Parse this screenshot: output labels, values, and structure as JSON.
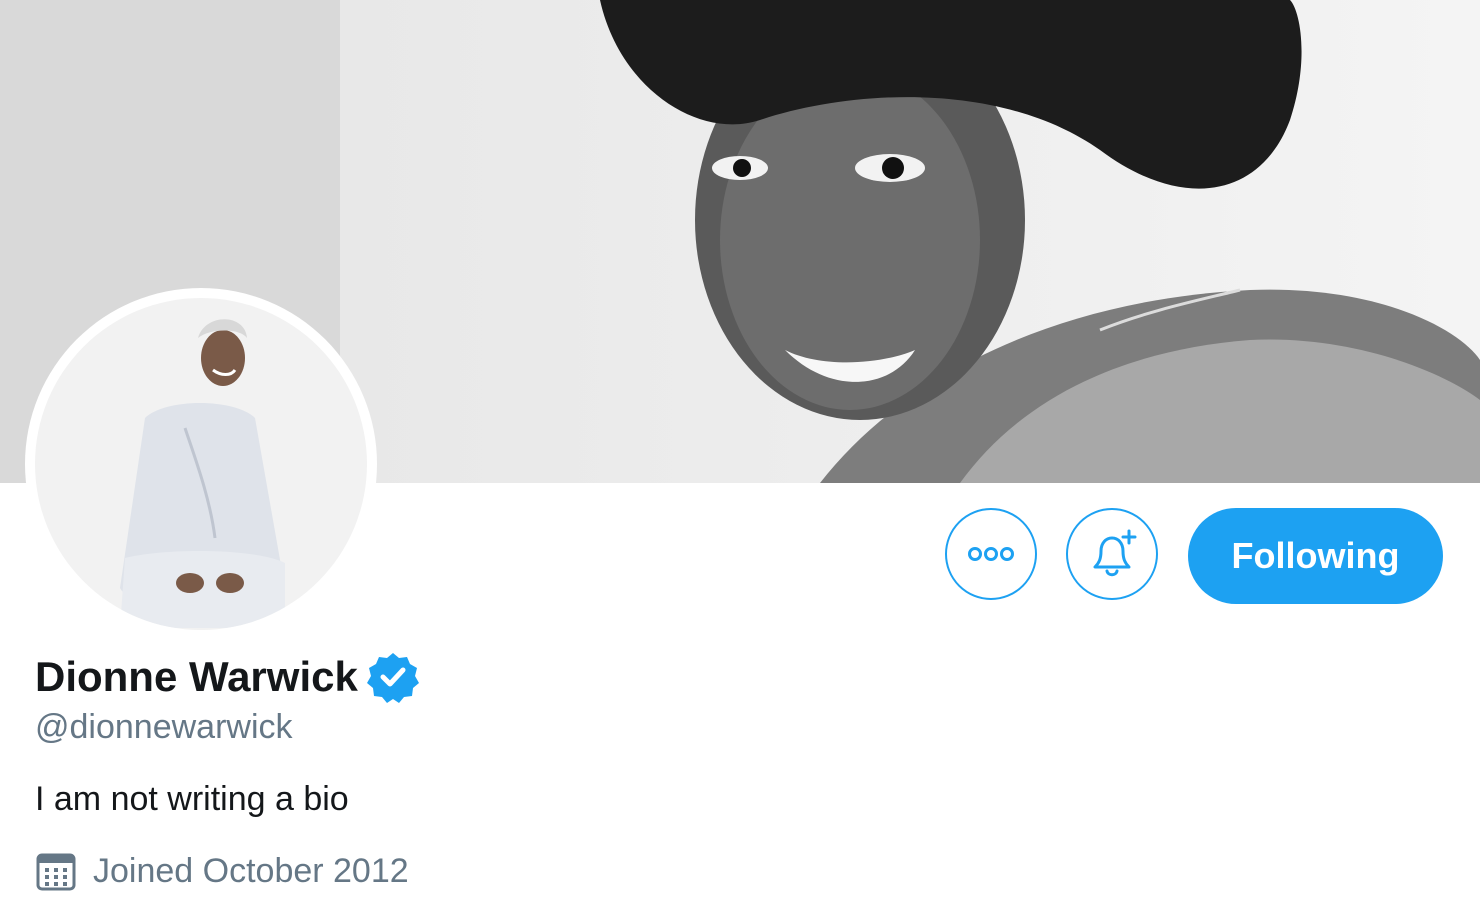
{
  "profile": {
    "display_name": "Dionne Warwick",
    "handle": "@dionnewarwick",
    "bio": "I am not writing a bio",
    "joined": "Joined October 2012",
    "verified": true
  },
  "actions": {
    "follow_label": "Following"
  },
  "icons": {
    "more": "more-horizontal-icon",
    "notify": "bell-plus-icon",
    "verified": "verified-badge-icon",
    "calendar": "calendar-icon"
  },
  "colors": {
    "accent": "#1da1f2",
    "text": "#14171a",
    "muted": "#657786",
    "banner_left": "#d9d9d9"
  }
}
